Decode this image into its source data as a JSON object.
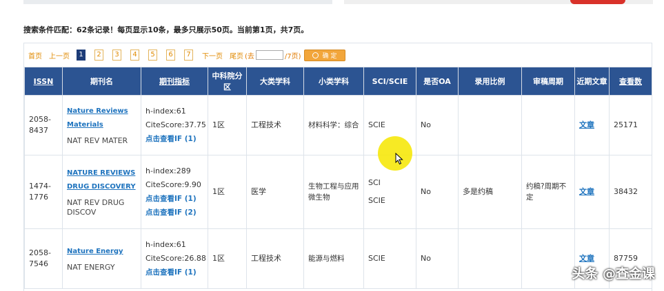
{
  "summary": "搜索条件匹配：62条记录！每页显示10条，最多只展示50页。当前第1页，共7页。",
  "pager": {
    "first": "首页",
    "prev": "上一页",
    "pages": [
      "1",
      "2",
      "3",
      "4",
      "5",
      "6",
      "7"
    ],
    "current": "1",
    "next": "下一页",
    "last": "尾页",
    "goto_prefix": "(去",
    "goto_suffix": "/7页)",
    "confirm": "确 定"
  },
  "table": {
    "headers": [
      "ISSN",
      "期刊名",
      "期刊指标",
      "中科院分区",
      "大类学科",
      "小类学科",
      "SCI/SCIE",
      "是否OA",
      "录用比例",
      "审稿周期",
      "近期文章",
      "查看数"
    ],
    "rows": [
      {
        "issn": "2058-8437",
        "title_lines": [
          "Nature Reviews",
          "Materials"
        ],
        "abbr": "NAT REV MATER",
        "hindex": "h-index:61",
        "citescore": "CiteScore:37.75",
        "if_links": [
          "点击查看IF (1)"
        ],
        "zone": "1区",
        "category": "工程技术",
        "subcategory": "材料科学：综合",
        "sci": [
          "SCIE"
        ],
        "oa": "No",
        "acceptance": "",
        "review": "",
        "articles": "文章",
        "views": "25171"
      },
      {
        "issn": "1474-1776",
        "title_lines": [
          "NATURE REVIEWS",
          "DRUG DISCOVERY"
        ],
        "abbr": "NAT REV DRUG DISCOV",
        "hindex": "h-index:289",
        "citescore": "CiteScore:9.90",
        "if_links": [
          "点击查看IF (1)",
          "点击查看IF (2)"
        ],
        "zone": "1区",
        "category": "医学",
        "subcategory": "生物工程与应用微生物",
        "sci": [
          "SCI",
          "SCIE"
        ],
        "oa": "No",
        "acceptance": "多是约稿",
        "review": "约稿?周期不定",
        "articles": "文章",
        "views": "38432"
      },
      {
        "issn": "2058-7546",
        "title_lines": [
          "Nature Energy"
        ],
        "abbr": "NAT ENERGY",
        "hindex": "h-index:61",
        "citescore": "CiteScore:26.88",
        "if_links": [
          "点击查看IF (1)"
        ],
        "zone": "1区",
        "category": "工程技术",
        "subcategory": "能源与燃料",
        "sci": [
          "SCIE"
        ],
        "oa": "No",
        "acceptance": "",
        "review": "",
        "articles": "文章",
        "views": "87759"
      }
    ]
  },
  "watermark": "头条 @查金课",
  "colors": {
    "header_bg": "#2c5492",
    "link": "#1e73be",
    "pager_accent": "#f2a63b",
    "highlight": "#f6e80c"
  }
}
